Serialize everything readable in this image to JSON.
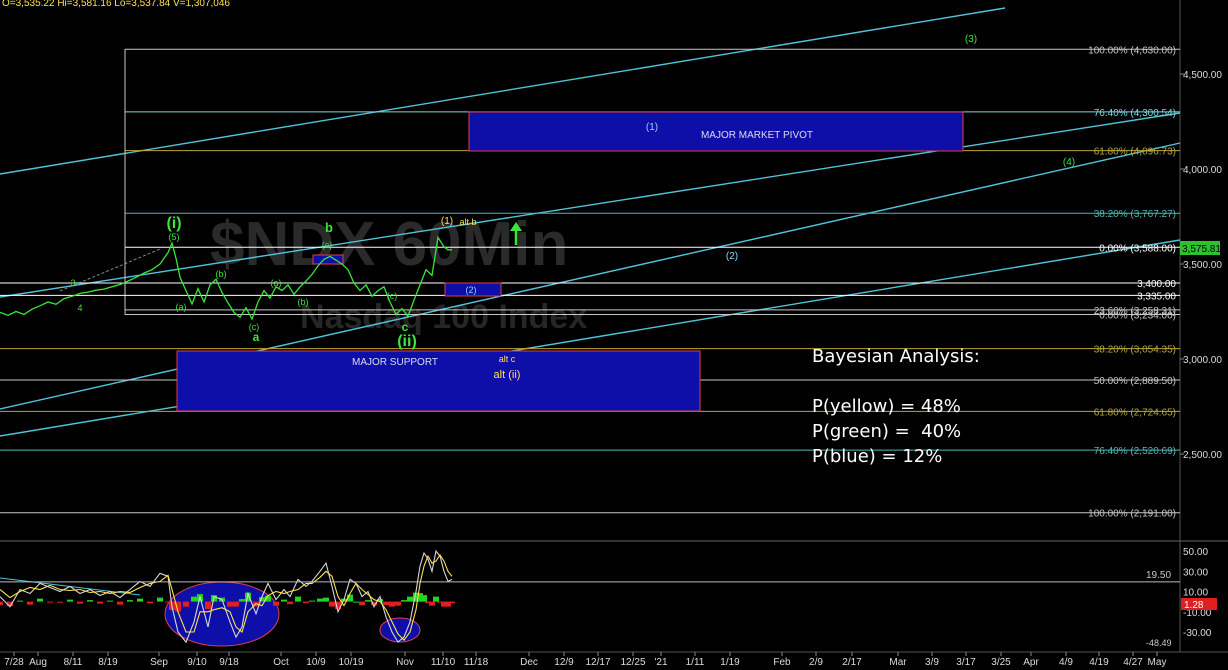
{
  "header": {
    "text": "O=3,535.22  Hi=3,581.16  Lo=3,537.84  V=1,307,046"
  },
  "watermark": {
    "symbol": "$NDX 60Min",
    "name": "Nasdaq 100 Index"
  },
  "chart_data": {
    "type": "line",
    "y_ticks": [
      {
        "v": 4500,
        "label": "4,500.00"
      },
      {
        "v": 4000,
        "label": "4,000.00"
      },
      {
        "v": 3500,
        "label": "3,500.00"
      },
      {
        "v": 3000,
        "label": "3,000.00"
      },
      {
        "v": 2500,
        "label": "2,500.00"
      }
    ],
    "ylim": [
      1900,
      4850
    ],
    "x_ticks": [
      "7/28",
      "Aug",
      "8/11",
      "8/19",
      "Sep",
      "9/10",
      "9/18",
      "Oct",
      "10/9",
      "10/19",
      "Nov",
      "11/10",
      "11/18",
      "Dec",
      "12/9",
      "12/17",
      "12/25",
      "'21",
      "1/11",
      "1/19",
      "Feb",
      "2/9",
      "2/17",
      "Mar",
      "3/9",
      "3/17",
      "3/25",
      "Apr",
      "4/9",
      "4/19",
      "4/27",
      "May"
    ],
    "last_price": {
      "v": 3575.81,
      "label": "3,575.81"
    },
    "fib_levels": [
      {
        "v": 4630.0,
        "label": "100.00% (4,630.00)",
        "color": "#c8c8c8"
      },
      {
        "v": 4300.54,
        "label": "76.40% (4,300.54)",
        "color": "#7fd6e0"
      },
      {
        "v": 4096.73,
        "label": "61.80% (4,096.73)",
        "color": "#b8a83a"
      },
      {
        "v": 3767.27,
        "label": "38.20% (3,767.27)",
        "color": "#4fb8b8"
      },
      {
        "v": 3588.0,
        "label": "0.00% (3,588.00)",
        "color": "#ffffff"
      },
      {
        "v": 3258.31,
        "label": "23.60% (3,258.31)",
        "color": "#c8c8c8"
      },
      {
        "v": 3234.0,
        "label": "0.00% (3,234.00)",
        "color": "#c8c8c8"
      },
      {
        "v": 3054.35,
        "label": "38.20% (3,054.35)",
        "color": "#b8a83a"
      },
      {
        "v": 2889.5,
        "label": "50.00% (2,889.50)",
        "color": "#c8c8c8"
      },
      {
        "v": 2724.65,
        "label": "61.80% (2,724.65)",
        "color": "#b8a83a"
      },
      {
        "v": 2520.69,
        "label": "76.40% (2,520.69)",
        "color": "#4fb8b8"
      },
      {
        "v": 2191.0,
        "label": "100.00% (2,191.00)",
        "color": "#c8c8c8"
      }
    ],
    "levels": [
      {
        "v": 3400.0,
        "label": "3,400.00"
      },
      {
        "v": 3335.0,
        "label": "3,335.00"
      }
    ],
    "price_series": [
      [
        0,
        3245
      ],
      [
        8,
        3230
      ],
      [
        16,
        3250
      ],
      [
        24,
        3235
      ],
      [
        32,
        3262
      ],
      [
        40,
        3280
      ],
      [
        48,
        3300
      ],
      [
        56,
        3288
      ],
      [
        64,
        3318
      ],
      [
        72,
        3330
      ],
      [
        80,
        3345
      ],
      [
        88,
        3352
      ],
      [
        96,
        3362
      ],
      [
        104,
        3368
      ],
      [
        112,
        3380
      ],
      [
        120,
        3392
      ],
      [
        128,
        3410
      ],
      [
        136,
        3430
      ],
      [
        144,
        3452
      ],
      [
        152,
        3470
      ],
      [
        160,
        3500
      ],
      [
        168,
        3560
      ],
      [
        172,
        3610
      ],
      [
        176,
        3530
      ],
      [
        180,
        3430
      ],
      [
        186,
        3360
      ],
      [
        192,
        3290
      ],
      [
        198,
        3370
      ],
      [
        204,
        3300
      ],
      [
        210,
        3390
      ],
      [
        216,
        3420
      ],
      [
        222,
        3350
      ],
      [
        228,
        3295
      ],
      [
        234,
        3245
      ],
      [
        240,
        3220
      ],
      [
        246,
        3270
      ],
      [
        252,
        3210
      ],
      [
        258,
        3300
      ],
      [
        264,
        3360
      ],
      [
        270,
        3320
      ],
      [
        276,
        3380
      ],
      [
        282,
        3360
      ],
      [
        288,
        3390
      ],
      [
        294,
        3340
      ],
      [
        300,
        3380
      ],
      [
        306,
        3410
      ],
      [
        312,
        3445
      ],
      [
        318,
        3490
      ],
      [
        324,
        3525
      ],
      [
        330,
        3540
      ],
      [
        336,
        3520
      ],
      [
        342,
        3500
      ],
      [
        348,
        3470
      ],
      [
        354,
        3400
      ],
      [
        360,
        3360
      ],
      [
        366,
        3390
      ],
      [
        372,
        3330
      ],
      [
        378,
        3360
      ],
      [
        384,
        3380
      ],
      [
        390,
        3300
      ],
      [
        396,
        3235
      ],
      [
        402,
        3265
      ],
      [
        408,
        3225
      ],
      [
        414,
        3310
      ],
      [
        420,
        3390
      ],
      [
        426,
        3470
      ],
      [
        432,
        3440
      ],
      [
        438,
        3640
      ],
      [
        444,
        3590
      ],
      [
        448,
        3575
      ],
      [
        452,
        3575
      ]
    ],
    "oscillator": {
      "y_ticks": [
        {
          "v": 50,
          "label": "50.00"
        },
        {
          "v": 30,
          "label": "30.00"
        },
        {
          "v": 10,
          "label": "10.00"
        },
        {
          "v": -10,
          "label": "-10.00"
        },
        {
          "v": -30,
          "label": "-30.00"
        }
      ],
      "ylim": [
        -52,
        58
      ],
      "reference": {
        "v": 19.5,
        "label": "19.50"
      },
      "current": {
        "v": 1.28,
        "label": "1.28"
      },
      "min_label": {
        "v": -48.49,
        "label": "-48.49"
      },
      "line_a": [
        [
          0,
          5
        ],
        [
          10,
          -5
        ],
        [
          20,
          12
        ],
        [
          30,
          8
        ],
        [
          40,
          18
        ],
        [
          50,
          14
        ],
        [
          60,
          10
        ],
        [
          70,
          15
        ],
        [
          80,
          8
        ],
        [
          90,
          12
        ],
        [
          100,
          6
        ],
        [
          110,
          10
        ],
        [
          120,
          4
        ],
        [
          130,
          12
        ],
        [
          140,
          20
        ],
        [
          150,
          15
        ],
        [
          160,
          28
        ],
        [
          168,
          25
        ],
        [
          172,
          -5
        ],
        [
          178,
          -30
        ],
        [
          186,
          -40
        ],
        [
          194,
          -20
        ],
        [
          200,
          5
        ],
        [
          208,
          -25
        ],
        [
          214,
          5
        ],
        [
          222,
          2
        ],
        [
          230,
          -20
        ],
        [
          236,
          -35
        ],
        [
          242,
          -25
        ],
        [
          248,
          8
        ],
        [
          256,
          -12
        ],
        [
          262,
          5
        ],
        [
          268,
          18
        ],
        [
          276,
          2
        ],
        [
          284,
          12
        ],
        [
          290,
          5
        ],
        [
          298,
          22
        ],
        [
          306,
          15
        ],
        [
          312,
          20
        ],
        [
          320,
          30
        ],
        [
          326,
          38
        ],
        [
          332,
          15
        ],
        [
          338,
          -10
        ],
        [
          344,
          2
        ],
        [
          350,
          22
        ],
        [
          356,
          18
        ],
        [
          362,
          5
        ],
        [
          368,
          10
        ],
        [
          374,
          -5
        ],
        [
          380,
          5
        ],
        [
          386,
          -15
        ],
        [
          392,
          -30
        ],
        [
          398,
          -40
        ],
        [
          404,
          -35
        ],
        [
          410,
          -20
        ],
        [
          416,
          10
        ],
        [
          420,
          35
        ],
        [
          424,
          48
        ],
        [
          428,
          42
        ],
        [
          432,
          30
        ],
        [
          436,
          50
        ],
        [
          440,
          45
        ],
        [
          444,
          30
        ],
        [
          448,
          20
        ],
        [
          452,
          22
        ]
      ],
      "line_b": [
        [
          0,
          12
        ],
        [
          10,
          4
        ],
        [
          20,
          10
        ],
        [
          30,
          14
        ],
        [
          40,
          12
        ],
        [
          50,
          16
        ],
        [
          60,
          12
        ],
        [
          70,
          11
        ],
        [
          80,
          12
        ],
        [
          90,
          9
        ],
        [
          100,
          10
        ],
        [
          110,
          8
        ],
        [
          120,
          10
        ],
        [
          130,
          9
        ],
        [
          140,
          14
        ],
        [
          150,
          18
        ],
        [
          160,
          20
        ],
        [
          168,
          26
        ],
        [
          172,
          12
        ],
        [
          178,
          -10
        ],
        [
          186,
          -30
        ],
        [
          194,
          -30
        ],
        [
          200,
          -10
        ],
        [
          208,
          -10
        ],
        [
          214,
          -8
        ],
        [
          222,
          -6
        ],
        [
          230,
          -10
        ],
        [
          236,
          -25
        ],
        [
          242,
          -30
        ],
        [
          248,
          -10
        ],
        [
          256,
          -2
        ],
        [
          262,
          -4
        ],
        [
          268,
          6
        ],
        [
          276,
          10
        ],
        [
          284,
          8
        ],
        [
          290,
          10
        ],
        [
          298,
          12
        ],
        [
          306,
          18
        ],
        [
          312,
          18
        ],
        [
          320,
          24
        ],
        [
          326,
          30
        ],
        [
          332,
          25
        ],
        [
          338,
          5
        ],
        [
          344,
          -4
        ],
        [
          350,
          8
        ],
        [
          356,
          18
        ],
        [
          362,
          12
        ],
        [
          368,
          7
        ],
        [
          374,
          2
        ],
        [
          380,
          0
        ],
        [
          386,
          -8
        ],
        [
          392,
          -20
        ],
        [
          398,
          -32
        ],
        [
          404,
          -38
        ],
        [
          410,
          -30
        ],
        [
          416,
          -8
        ],
        [
          420,
          18
        ],
        [
          424,
          35
        ],
        [
          428,
          45
        ],
        [
          432,
          38
        ],
        [
          436,
          40
        ],
        [
          440,
          46
        ],
        [
          444,
          40
        ],
        [
          448,
          30
        ],
        [
          452,
          25
        ]
      ]
    }
  },
  "annotations": {
    "major_market_pivot": "MAJOR MARKET PIVOT",
    "major_support": "MAJOR SUPPORT",
    "alt_c": "alt c",
    "alt_ii": "alt (ii)",
    "alt_b": "alt b",
    "yellow_1": "(1)",
    "wave_i": "(i)",
    "wave_ii": "(ii)",
    "wave_b": "b",
    "wave_a": "a",
    "wave_c": "c",
    "wave_5": "(5)",
    "wave_3": "3",
    "wave_4": "4",
    "wave_a_paren": "(a)",
    "wave_b_paren": "(b)",
    "wave_c_paren": "(c)",
    "wave_a_paren_2": "(a)",
    "wave_b_paren_2": "(b)",
    "wave_c_paren_2": "(c)",
    "wave_c_paren_3": "(c)",
    "blue_1": "(1)",
    "blue_2": "(2)",
    "blue_2_box": "(2)",
    "green_3": "(3)",
    "green_4": "(4)",
    "colors": {
      "green": "#39e639",
      "yellow": "#ffe34d",
      "blue": "#8fd9ff",
      "box_fill": "#0e0ea8",
      "box_border": "#e0404a",
      "channel": "#4fc3d9"
    }
  },
  "analysis": {
    "title": "Bayesian Analysis:",
    "p_yellow": "P(yellow) = 48%",
    "p_green": "P(green) =  40%",
    "p_blue": "P(blue) = 12%"
  }
}
